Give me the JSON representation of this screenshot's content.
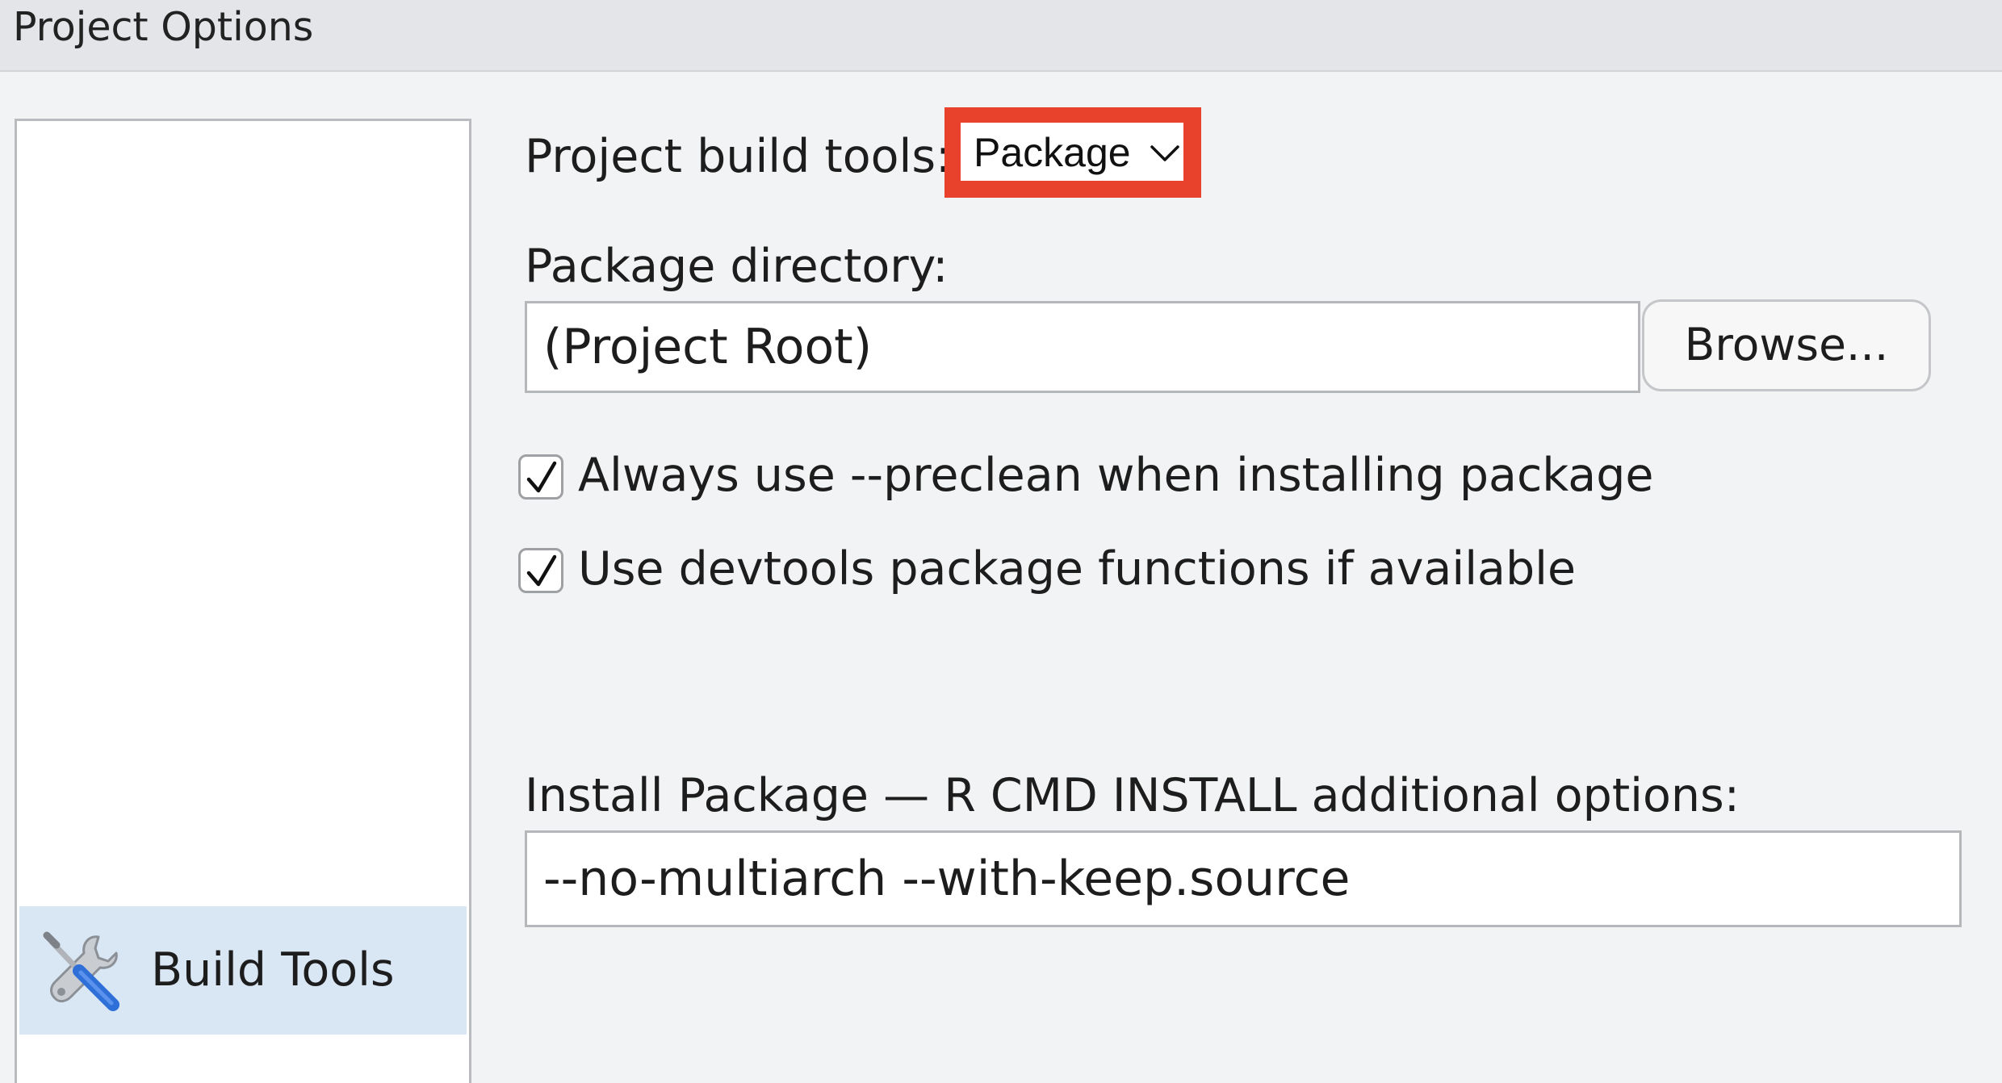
{
  "window": {
    "title": "Project Options"
  },
  "sidebar": {
    "items": [
      {
        "label": "Build Tools",
        "icon": "build-tools-icon",
        "selected": true
      }
    ]
  },
  "build_tools": {
    "label": "Project build tools:",
    "selected": "Package",
    "options": [
      "Package"
    ],
    "highlight_color": "#e8422c"
  },
  "package_directory": {
    "label": "Package directory:",
    "value": "(Project Root)",
    "browse_label": "Browse..."
  },
  "checkboxes": [
    {
      "label": "Always use --preclean when installing package",
      "checked": true
    },
    {
      "label": "Use devtools package functions if available",
      "checked": true
    }
  ],
  "install_package": {
    "label": "Install Package — R CMD INSTALL additional options:",
    "value": "--no-multiarch --with-keep.source"
  },
  "colors": {
    "sidebar_selected": "#d9e6f4",
    "icon_handle": "#2f6fd8"
  }
}
